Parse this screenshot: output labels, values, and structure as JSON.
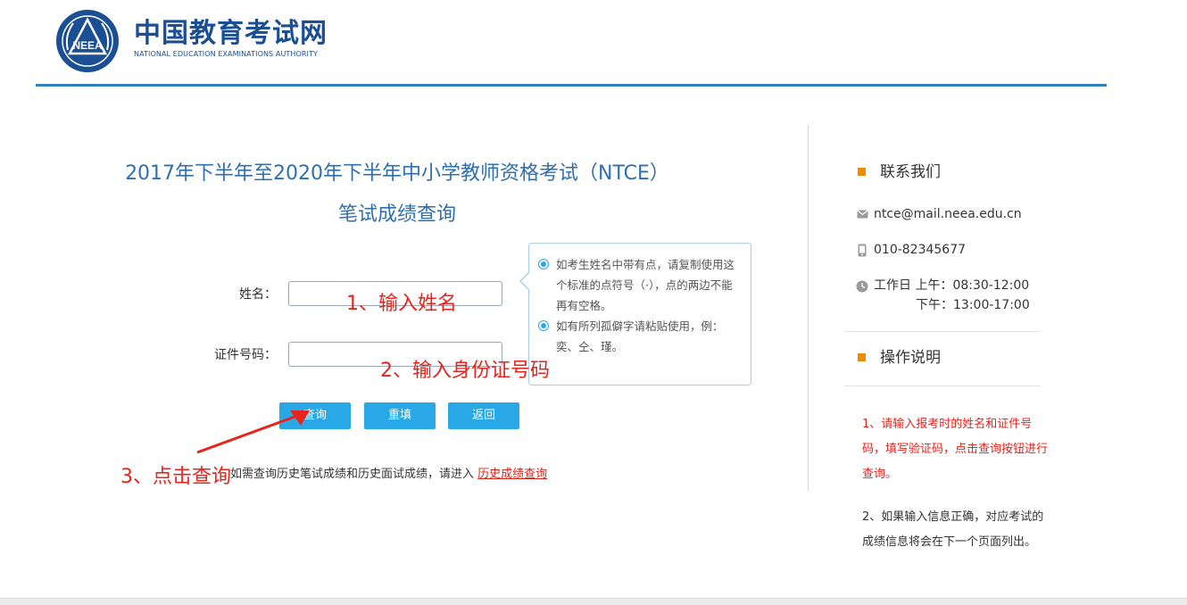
{
  "header": {
    "brand_cn": "中国教育考试网",
    "brand_en": "NATIONAL EDUCATION EXAMINATIONS AUTHORITY",
    "logo_text": "NEEA"
  },
  "main": {
    "title_line1": "2017年下半年至2020年下半年中小学教师资格考试（NTCE）",
    "title_line2": "笔试成绩查询",
    "form": {
      "name_label": "姓名：",
      "name_value": "",
      "id_label": "证件号码：",
      "id_value": ""
    },
    "buttons": {
      "query": "查询",
      "reset": "重填",
      "back": "返回"
    },
    "history_text": "如需查询历史笔试成绩和历史面试成绩，请进入",
    "history_link": "历史成绩查询"
  },
  "tooltip": {
    "items": [
      "如考生姓名中带有点，请复制使用这个标准的点符号（·），点的两边不能再有空格。",
      "如有所列孤僻字请粘贴使用，例：奕、仝、瑾。"
    ]
  },
  "annotations": {
    "step1": "1、输入姓名",
    "step2": "2、输入身份证号码",
    "step3": "3、点击查询"
  },
  "sidebar": {
    "contact_heading": "联系我们",
    "email": "ntce@mail.neea.edu.cn",
    "phone": "010-82345677",
    "hours_line1": "工作日 上午：08:30-12:00",
    "hours_line2": "下午：13:00-17:00",
    "instructions_heading": "操作说明",
    "instruction1": "1、请输入报考时的姓名和证件号码，填写验证码，点击查询按钮进行查询。",
    "instruction2": "2、如果输入信息正确，对应考试的成绩信息将会在下一个页面列出。"
  },
  "colors": {
    "brand_blue": "#1a4f93",
    "title_blue": "#2f6fae",
    "button_blue": "#29a8e8",
    "annotation_red": "#e8231c",
    "accent_orange": "#f08a00"
  }
}
